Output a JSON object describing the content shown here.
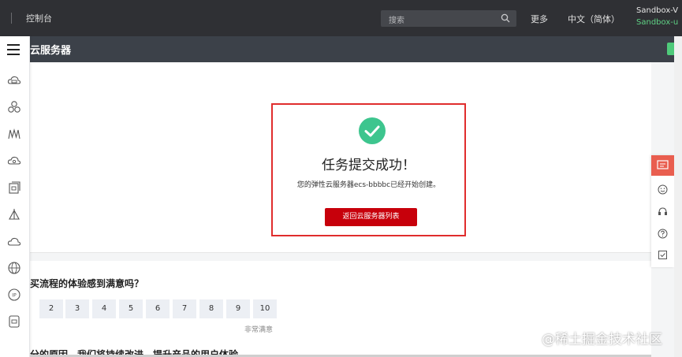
{
  "topbar": {
    "console_label": "控制台",
    "search_placeholder": "搜索",
    "more_label": "更多",
    "lang_label": "中文（简体）",
    "account_line1": "Sandbox-V",
    "account_line2": "Sandbox-u"
  },
  "subheader": {
    "title": "云服务器"
  },
  "success": {
    "title": "任务提交成功！",
    "description": "您的弹性云服务器ecs-bbbbc已经开始创建。",
    "back_button": "返回云服务器列表"
  },
  "survey": {
    "question1": "买流程的体验感到满意吗？",
    "ratings": [
      "2",
      "3",
      "4",
      "5",
      "6",
      "7",
      "8",
      "9",
      "10"
    ],
    "very_satisfied": "非常满意",
    "question2": "分的原因，我们将持续改进，提升产品的用户体验"
  },
  "watermark": "@稀土掘金技术社区",
  "colors": {
    "topbar_bg": "#2f3034",
    "subheader_bg": "#3c4149",
    "primary_red": "#c7000b",
    "highlight_border": "#e02d2d",
    "success_green": "#3dc58e",
    "account_green": "#5fd184",
    "feedback_red": "#e95e4f"
  },
  "icons": {
    "sidebar": [
      "cloud-server-icon",
      "cluster-icon",
      "bandwidth-icon",
      "cloud-storage-icon",
      "image-icon",
      "network-icon",
      "cloud-icon",
      "globe-icon",
      "ip-icon",
      "document-icon"
    ],
    "right_toolbar": [
      "feedback-icon",
      "smile-icon",
      "headset-icon",
      "help-icon",
      "checklist-icon"
    ]
  }
}
